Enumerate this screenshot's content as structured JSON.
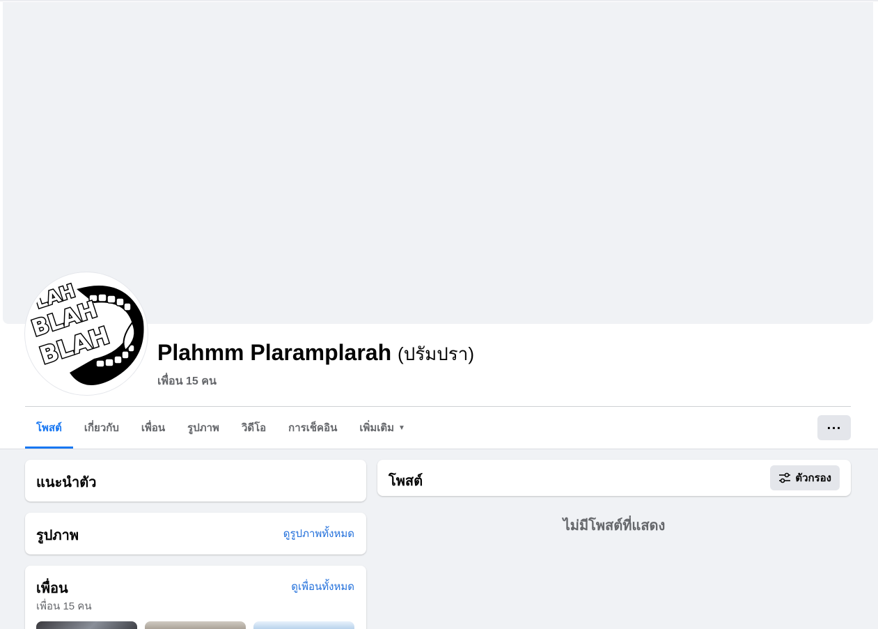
{
  "profile": {
    "name": "Plahmm Plaramplarah",
    "alternate_name": "(ปรัมปรา)",
    "friend_count_text": "เพื่อน 15 คน"
  },
  "tabs": [
    {
      "label": "โพสต์",
      "active": true
    },
    {
      "label": "เกี่ยวกับ",
      "active": false
    },
    {
      "label": "เพื่อน",
      "active": false
    },
    {
      "label": "รูปภาพ",
      "active": false
    },
    {
      "label": "วิดีโอ",
      "active": false
    },
    {
      "label": "การเช็คอิน",
      "active": false
    },
    {
      "label": "เพิ่มเติม",
      "active": false
    }
  ],
  "more_button": {
    "label": "···"
  },
  "intro": {
    "title": "แนะนำตัว"
  },
  "photos": {
    "title": "รูปภาพ",
    "see_all": "ดูรูปภาพทั้งหมด"
  },
  "friends": {
    "title": "เพื่อน",
    "subtitle": "เพื่อน 15 คน",
    "see_all": "ดูเพื่อนทั้งหมด"
  },
  "posts": {
    "title": "โพสต์",
    "filter_label": "ตัวกรอง",
    "empty_text": "ไม่มีโพสต์ที่แสดง"
  },
  "avatar_logo_text": "BLAH BLAH BLAH",
  "icons": {
    "more": "ellipsis-icon",
    "filter": "sliders-icon",
    "dropdown": "caret-down-icon"
  },
  "colors": {
    "accent": "#1877f2",
    "link": "#216fdb",
    "background": "#f0f2f5",
    "secondary_text": "#65676b",
    "button_gray": "#e4e6eb"
  }
}
